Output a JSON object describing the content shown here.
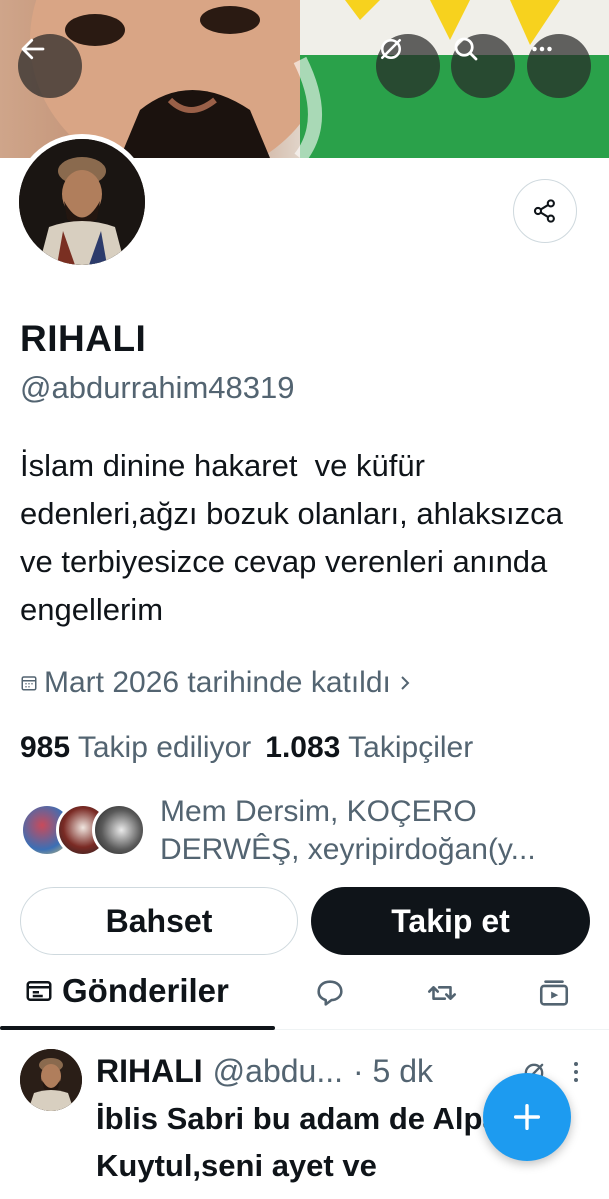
{
  "header": {
    "back_icon": "arrow-left-icon",
    "grok_icon": "grok-icon",
    "search_icon": "search-icon",
    "more_icon": "more-horizontal-icon"
  },
  "profile": {
    "display_name": "RIHALI",
    "handle": "@abdurrahim48319",
    "bio": "İslam dinine hakaret  ve küfür edenleri,ağzı bozuk olanları, ahlaksızca ve terbiyesizce cevap verenleri anında engellerim",
    "joined": "Mart 2026 tarihinde katıldı",
    "following_count": "985",
    "following_label": "Takip ediliyor",
    "followers_count": "1.083",
    "followers_label": "Takipçiler",
    "known_followers": "Mem Dersim, KOÇERO DERWÊŞ, xeyripirdoğan(y..."
  },
  "actions": {
    "mention_label": "Bahset",
    "follow_label": "Takip et"
  },
  "tabs": {
    "posts_label": "Gönderiler"
  },
  "post": {
    "name": "RIHALI",
    "handle": "@abdu...",
    "time": "· 5 dk",
    "text": "İblis Sabri bu adam de Alpaslan Kuytul,seni ayet ve"
  },
  "colors": {
    "accent": "#1d9bf0",
    "text_primary": "#0f1419",
    "text_secondary": "#536471"
  }
}
